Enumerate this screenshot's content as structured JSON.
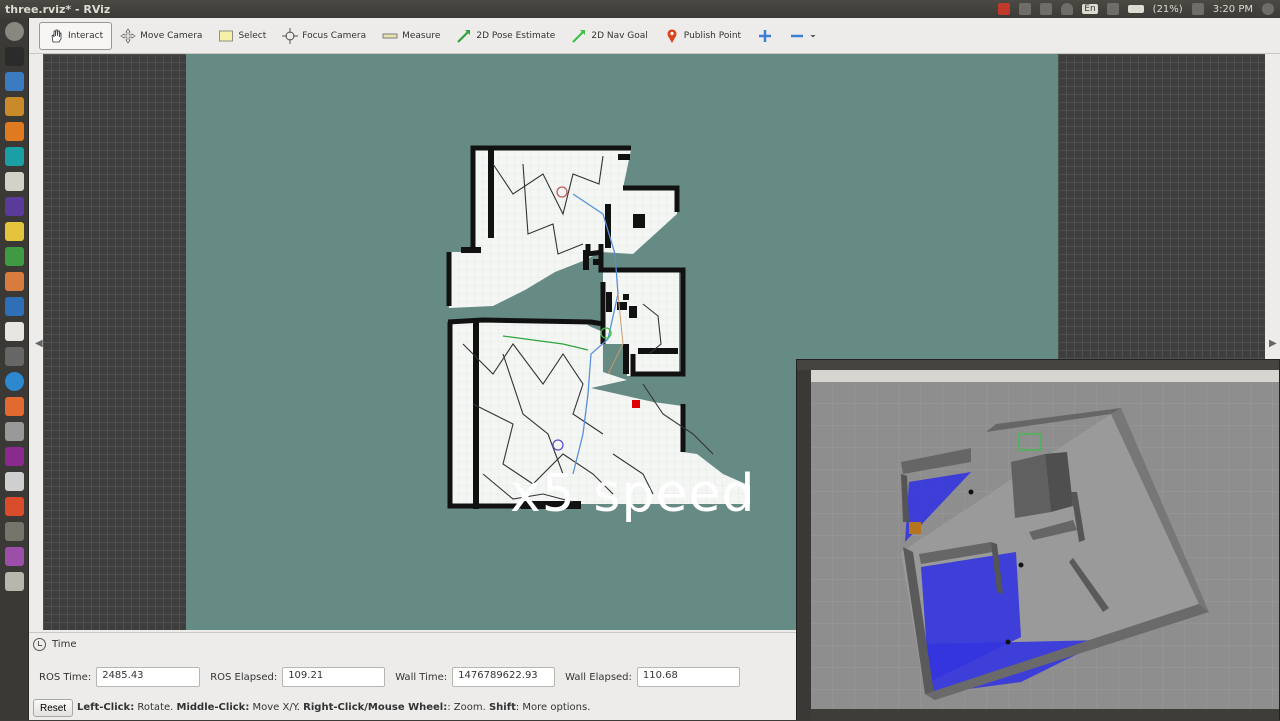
{
  "window": {
    "title": "three.rviz* - RViz"
  },
  "tray": {
    "lang": "En",
    "battery": "(21%)",
    "clock": "3:20 PM"
  },
  "toolbar": {
    "interact": "Interact",
    "move_camera": "Move Camera",
    "select": "Select",
    "focus_camera": "Focus Camera",
    "measure": "Measure",
    "pose_estimate": "2D Pose Estimate",
    "nav_goal": "2D Nav Goal",
    "publish_point": "Publish Point"
  },
  "overlay": {
    "speed_text": "x5 speed"
  },
  "time_panel": {
    "title": "Time",
    "ros_time_label": "ROS Time:",
    "ros_time": "2485.43",
    "ros_elapsed_label": "ROS Elapsed:",
    "ros_elapsed": "109.21",
    "wall_time_label": "Wall Time:",
    "wall_time": "1476789622.93",
    "wall_elapsed_label": "Wall Elapsed:",
    "wall_elapsed": "110.68",
    "reset_label": "Reset",
    "hint_left_click": "Left-Click:",
    "hint_left_text": " Rotate. ",
    "hint_middle_click": "Middle-Click:",
    "hint_middle_text": " Move X/Y. ",
    "hint_right_click": "Right-Click/Mouse Wheel:",
    "hint_right_text": ": Zoom. ",
    "hint_shift": "Shift",
    "hint_shift_text": ": More options."
  },
  "colors": {
    "map_bg": "#668a84",
    "goal_marker": "#e00000",
    "path_blue": "#5a8fd8",
    "gazebo_laser": "#3434e0"
  }
}
